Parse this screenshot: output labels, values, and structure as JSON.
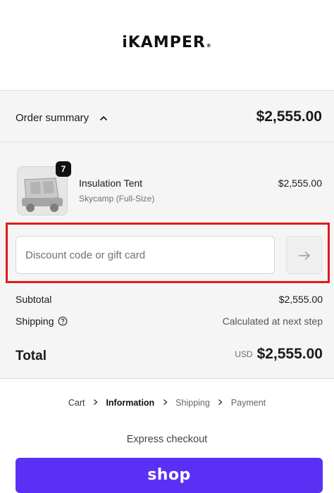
{
  "brand": {
    "logo_text": "iKAMPER",
    "logo_mark": "®"
  },
  "order_summary": {
    "toggle_label": "Order summary",
    "toggle_icon": "chevron-up-icon",
    "total": "$2,555.00"
  },
  "line_items": [
    {
      "quantity": "7",
      "name": "Insulation Tent",
      "variant": "Skycamp (Full-Size)",
      "price": "$2,555.00"
    }
  ],
  "discount": {
    "placeholder": "Discount code or gift card",
    "value": "",
    "apply_icon": "arrow-right-icon"
  },
  "costs": {
    "subtotal_label": "Subtotal",
    "subtotal_value": "$2,555.00",
    "shipping_label": "Shipping",
    "shipping_help_icon": "question-circle-icon",
    "shipping_value": "Calculated at next step",
    "total_label": "Total",
    "currency": "USD",
    "total_value": "$2,555.00"
  },
  "breadcrumb": {
    "items": [
      "Cart",
      "Information",
      "Shipping",
      "Payment"
    ],
    "active": "Information",
    "separator_icon": "chevron-right-icon"
  },
  "express_checkout": {
    "label": "Express checkout",
    "shop_pay_label": "shop"
  },
  "colors": {
    "highlight_border": "#e21a1a",
    "shop_pay": "#5a31f4",
    "summary_bg": "#f5f5f5"
  }
}
